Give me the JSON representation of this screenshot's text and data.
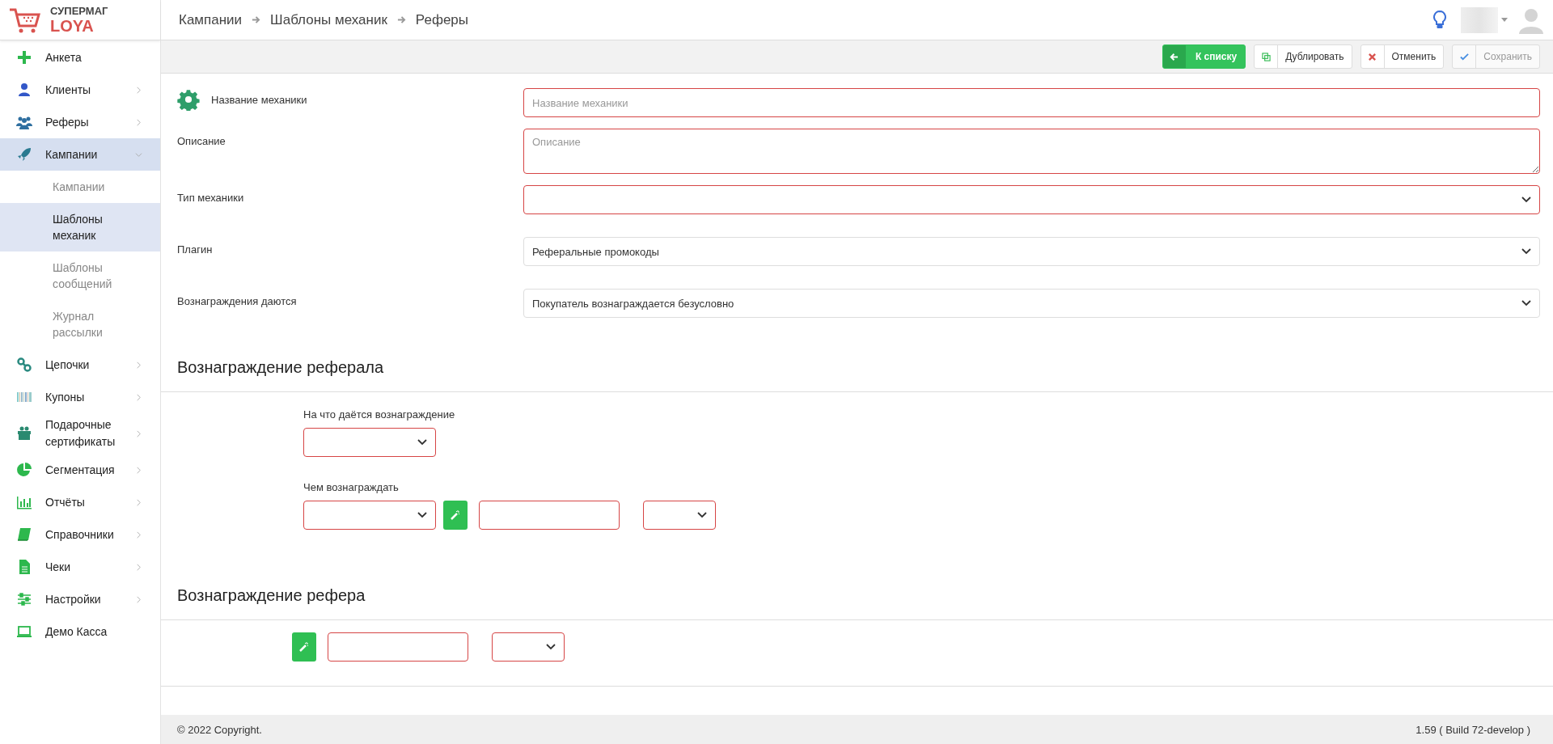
{
  "logo": {
    "line1": "СУПЕРМАГ",
    "line2": "LOYA"
  },
  "breadcrumbs": [
    "Кампании",
    "Шаблоны механик",
    "Реферы"
  ],
  "sidebar": {
    "items": [
      {
        "label": "Анкета",
        "kind": "link",
        "selected": false
      },
      {
        "label": "Клиенты",
        "kind": "group",
        "expanded": false,
        "selected": false
      },
      {
        "label": "Реферы",
        "kind": "group",
        "expanded": false,
        "selected": false
      },
      {
        "label": "Кампании",
        "kind": "group",
        "expanded": true,
        "selected": true,
        "children": [
          {
            "label": "Кампании",
            "selected": false
          },
          {
            "label": "Шаблоны механик",
            "selected": true
          },
          {
            "label": "Шаблоны сообщений",
            "selected": false
          },
          {
            "label": "Журнал рассылки",
            "selected": false
          }
        ]
      },
      {
        "label": "Цепочки",
        "kind": "group",
        "expanded": false,
        "selected": false
      },
      {
        "label": "Купоны",
        "kind": "group",
        "expanded": false,
        "selected": false
      },
      {
        "label": "Подарочные сертификаты",
        "kind": "group",
        "expanded": false,
        "selected": false
      },
      {
        "label": "Сегментация",
        "kind": "group",
        "expanded": false,
        "selected": false
      },
      {
        "label": "Отчёты",
        "kind": "group",
        "expanded": false,
        "selected": false
      },
      {
        "label": "Справочники",
        "kind": "group",
        "expanded": false,
        "selected": false
      },
      {
        "label": "Чеки",
        "kind": "group",
        "expanded": false,
        "selected": false
      },
      {
        "label": "Настройки",
        "kind": "group",
        "expanded": false,
        "selected": false
      },
      {
        "label": "Демо Касса",
        "kind": "link",
        "selected": false
      }
    ]
  },
  "toolbar": [
    {
      "label": "К списку",
      "kind": "primary",
      "disabled": false
    },
    {
      "label": "Дублировать",
      "kind": "duplicate",
      "disabled": false
    },
    {
      "label": "Отменить",
      "kind": "cancel",
      "disabled": false
    },
    {
      "label": "Сохранить",
      "kind": "save",
      "disabled": true
    }
  ],
  "form": [
    {
      "label": "Название механики",
      "kind": "input",
      "placeholder": "Название механики",
      "invalid": true
    },
    {
      "label": "Описание",
      "kind": "textarea",
      "placeholder": "Описание",
      "invalid": true
    },
    {
      "label": "Тип механики",
      "kind": "select",
      "invalid": true
    },
    {
      "label": "Плагин",
      "kind": "select",
      "value": "Реферальные промокоды",
      "invalid": false
    },
    {
      "label": "Вознаграждения даются",
      "kind": "select",
      "value": "Покупатель вознаграждается безусловно",
      "invalid": false
    }
  ],
  "referral_reward": {
    "title": "Вознаграждение реферала",
    "for_what": {
      "label": "На что даётся вознаграждение",
      "invalid": true
    },
    "with_what": {
      "label": "Чем вознаграждать",
      "select_invalid": true,
      "amount_invalid": true,
      "unit_invalid": true
    }
  },
  "referrer_reward": {
    "title": "Вознаграждение рефера",
    "amount_invalid": true,
    "unit_invalid": true
  },
  "footer": {
    "copyright": "© 2022 Copyright.",
    "version": "1.59 ( Build 72-develop )"
  }
}
